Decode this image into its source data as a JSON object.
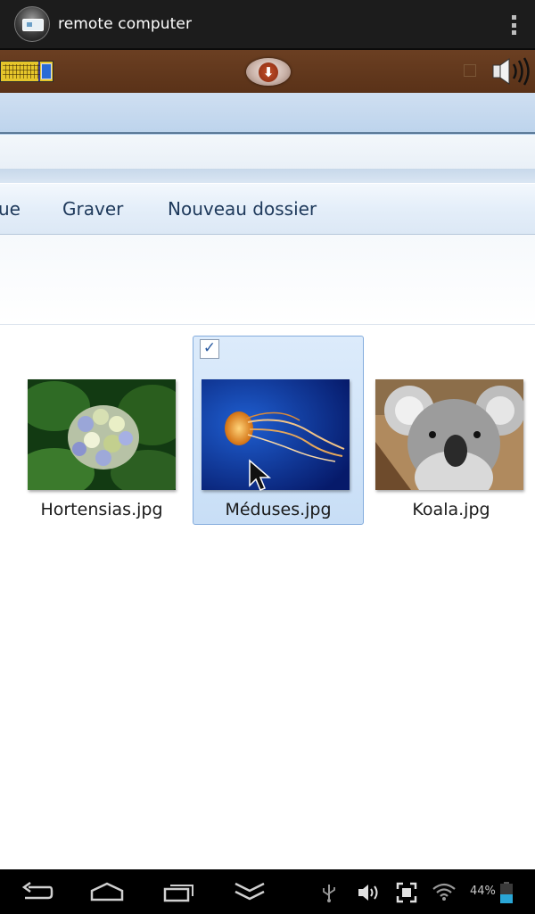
{
  "app": {
    "title": "remote computer"
  },
  "explorer": {
    "commands": [
      "ue",
      "Graver",
      "Nouveau dossier"
    ],
    "files": [
      {
        "name": "Hortensias.jpg",
        "selected": false
      },
      {
        "name": "Méduses.jpg",
        "selected": true
      },
      {
        "name": "Koala.jpg",
        "selected": false
      }
    ]
  },
  "status": {
    "battery": "44%"
  },
  "colors": {
    "toolbar_brown": "#5a3218",
    "selection_blue": "#c8def6",
    "battery_fill": "#2aa6d6"
  }
}
